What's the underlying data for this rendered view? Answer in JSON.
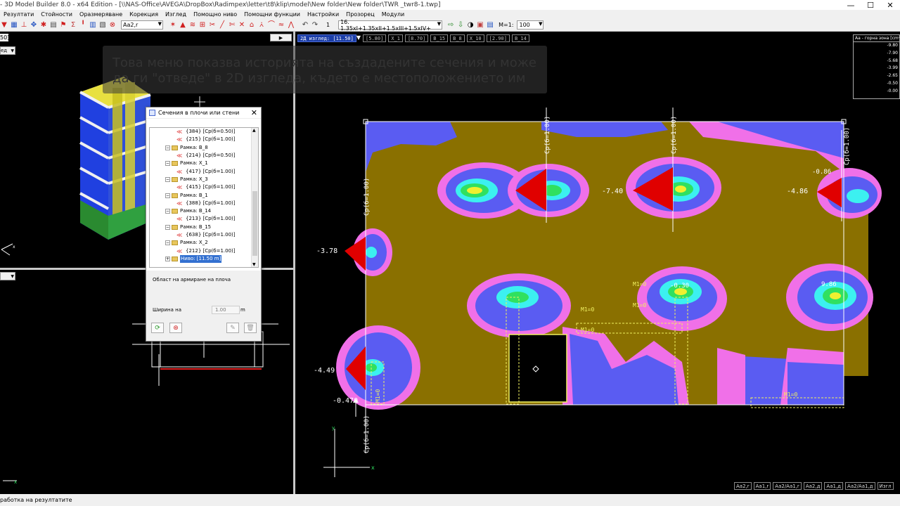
{
  "titlebar": {
    "text": "- 3D Model Builder 8.0 - x64 Edition - [\\\\NAS-Office\\AVEGA\\DropBox\\Radimpex\\letter\\t8\\klip\\model\\New folder\\New folder\\TWR _twr8-1.twp]",
    "minimize": "—",
    "maximize": "☐",
    "close": "✕"
  },
  "menubar": [
    "Резултати",
    "Стойности",
    "Оразмеряване",
    "Корекция",
    "Изглед",
    "Помощно ниво",
    "Помощни функции",
    "Настройки",
    "Прозорец",
    "Модули"
  ],
  "toolbar": {
    "armature_select": "Aa2,r",
    "level_number": "1",
    "load_combination": "16. 1.35xI+1.35xII+1.5xIII+1.5xIV+",
    "scale_label": "M=1:",
    "scale_value": "100"
  },
  "left_pane": {
    "top_label": "50]",
    "view_select": "ед",
    "lower_select": ""
  },
  "tooltip": {
    "text": "Това меню показва историята на създадените сечения и може да ги \"отведе\" в 2D изгледа, където е местоположението им"
  },
  "dialog": {
    "title": "Сечения в плочи или стени",
    "close": "✕",
    "tree": [
      {
        "kind": "section",
        "text": "{384} [Ср(б=0.50)]"
      },
      {
        "kind": "section",
        "text": "{215} [Ср(б=1.00)]"
      },
      {
        "kind": "frame",
        "text": "Рамка: В_8"
      },
      {
        "kind": "section",
        "text": "{214} [Ср(б=0.50)]"
      },
      {
        "kind": "frame",
        "text": "Рамка: X_1"
      },
      {
        "kind": "section",
        "text": "{417} [Ср(б=1.00)]"
      },
      {
        "kind": "frame",
        "text": "Рамка: X_3"
      },
      {
        "kind": "section",
        "text": "{415} [Ср(б=1.00)]"
      },
      {
        "kind": "frame",
        "text": "Рамка: В_1"
      },
      {
        "kind": "section",
        "text": "{388} [Ср(б=1.00)]"
      },
      {
        "kind": "frame",
        "text": "Рамка: В_14"
      },
      {
        "kind": "section",
        "text": "{213} [Ср(б=1.00)]"
      },
      {
        "kind": "frame",
        "text": "Рамка: В_15"
      },
      {
        "kind": "section",
        "text": "{638} [Ср(б=1.00)]"
      },
      {
        "kind": "frame",
        "text": "Рамка: X_2"
      },
      {
        "kind": "section",
        "text": "{212} [Ср(б=1.00)]"
      },
      {
        "kind": "level",
        "text": "Ниво: [11.50 m]"
      }
    ],
    "group_label": "Област на армиране на плоча",
    "width_label": "Ширина на",
    "width_value": "1.00",
    "width_unit": "m"
  },
  "view2d": {
    "tabs": [
      "2Д изглед: [11.50]",
      "[5.80]",
      "X_1",
      "[8.70]",
      "В_15",
      "В_8",
      "X_10",
      "[2.90]",
      "В_14"
    ],
    "values": [
      "-7.40",
      "-4.86",
      "-0.86",
      "-3.78",
      "-4.49",
      "-0.470",
      "9.86",
      "-0.30"
    ],
    "markers": [
      "Ср(б=1.00)",
      "Ср(б=1.00)",
      "Ср(б=1.00)",
      "Ср(б=1.00)",
      "Ср(б=1.00)"
    ],
    "m1_labels": [
      "M1=0",
      "M1=0",
      "M1=0",
      "M1=0",
      "M1=0",
      "M1=0"
    ],
    "axis_x": "x",
    "axis_y": "y"
  },
  "legend": {
    "title": "Aa - горна зона [cm²/m]",
    "values": [
      "-9.80",
      "-7.90",
      "-5.68",
      "-3.99",
      "-2.65",
      "-0.50",
      "-0.00"
    ]
  },
  "bottom_tabs": [
    "Aa2,r",
    "Aa1,r",
    "Aa2/Aa1,r",
    "Aa2,д",
    "Aa1,д",
    "Aa2/Aa1,д",
    "Изгл"
  ],
  "statusbar": {
    "text": "работка на резултатите"
  },
  "colors": {
    "olive": "#8a7000",
    "blue": "#5a5cf2",
    "magenta": "#f070e8",
    "cyan": "#3cf0f0",
    "green": "#30e060",
    "yellow": "#f0f030",
    "red": "#e00000"
  }
}
